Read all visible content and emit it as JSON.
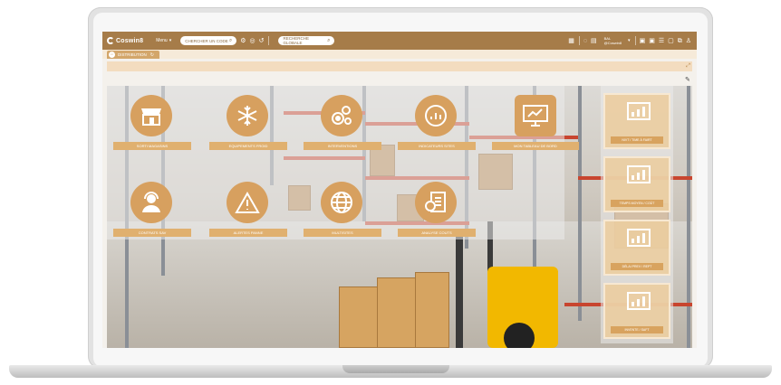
{
  "app": {
    "brand": "Coswin8",
    "menu_label": "Menu",
    "search_code_placeholder": "CHERCHER UN CODE",
    "global_search_placeholder": "RECHERCHE GLOBALE",
    "user_line1": "BAL",
    "user_line2": "@Coswin8"
  },
  "tabs": [
    {
      "label": "DISTRIBUTION"
    }
  ],
  "tiles": [
    {
      "label": "SORTI MAGASINS",
      "icon": "store-icon"
    },
    {
      "label": "EQUIPEMENTS FROID",
      "icon": "snowflake-icon"
    },
    {
      "label": "INTERVENTIONS",
      "icon": "gears-icon"
    },
    {
      "label": "INDICATEURS SITES",
      "icon": "gauge-icon"
    },
    {
      "label": "MON TABLEAU DE BORD",
      "icon": "dashboard-icon"
    },
    {
      "label": "CONTRATS SAV",
      "icon": "support-agent-icon"
    },
    {
      "label": "ALERTES PANNE",
      "icon": "warning-icon"
    },
    {
      "label": "MULTISITES",
      "icon": "globe-icon"
    },
    {
      "label": "ANALYSE COUTS",
      "icon": "cost-report-icon"
    }
  ],
  "side_tiles": [
    {
      "label": "NIVT / TIME À FAIRT",
      "icon": "chart-monitor-icon"
    },
    {
      "label": "TEMPS MOYEN / COÛT",
      "icon": "chart-monitor-icon"
    },
    {
      "label": "DÉLAI PREV / REPT",
      "icon": "chart-monitor-icon"
    },
    {
      "label": "INVENTE / SAFT",
      "icon": "chart-monitor-icon"
    }
  ],
  "colors": {
    "topbar": "#a67c49",
    "tile": "#d7a05f",
    "accent_light": "#f3dcbf"
  }
}
